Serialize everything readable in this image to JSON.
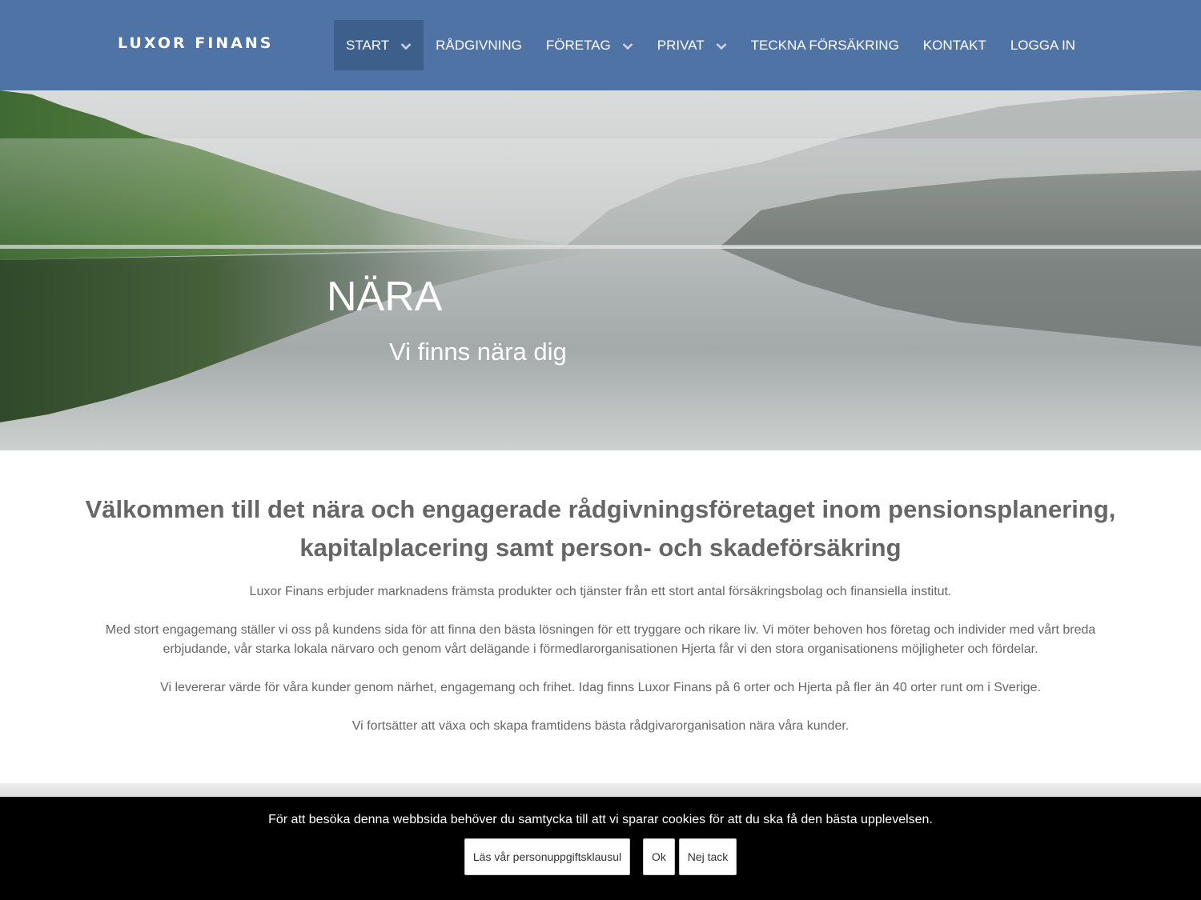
{
  "header": {
    "logo": "LUXOR FINANS",
    "nav": [
      {
        "label": "START",
        "has_dropdown": true,
        "active": true
      },
      {
        "label": "RÅDGIVNING",
        "has_dropdown": false,
        "active": false
      },
      {
        "label": "FÖRETAG",
        "has_dropdown": true,
        "active": false
      },
      {
        "label": "PRIVAT",
        "has_dropdown": true,
        "active": false
      },
      {
        "label": "TECKNA FÖRSÄKRING",
        "has_dropdown": false,
        "active": false
      },
      {
        "label": "KONTAKT",
        "has_dropdown": false,
        "active": false
      },
      {
        "label": "LOGGA IN",
        "has_dropdown": false,
        "active": false
      }
    ]
  },
  "hero": {
    "title": "NÄRA",
    "subtitle": "Vi finns nära dig"
  },
  "main": {
    "heading": "Välkommen till det nära och engagerade rådgivningsföretaget inom pensionsplanering, kapitalplacering samt person- och skadeförsäkring",
    "paragraphs": [
      "Luxor Finans erbjuder marknadens främsta produkter och tjänster från ett stort antal försäkringsbolag och finansiella institut.",
      "Med stort engagemang ställer vi oss på kundens sida för att finna den bästa lösningen för ett tryggare och rikare liv. Vi möter behoven hos företag och individer med vårt breda erbjudande, vår starka lokala närvaro och genom vårt delägande i förmedlarorganisationen Hjerta får vi den stora organisationens möjligheter och fördelar.",
      "Vi levererar värde för våra kunder genom närhet, engagemang och frihet. Idag finns Luxor Finans på 6 orter och Hjerta på fler än 40 orter runt om i Sverige.",
      "Vi fortsätter att växa och skapa framtidens bästa rådgivarorganisation nära våra kunder."
    ]
  },
  "cookie_bar": {
    "text": "För att besöka denna webbsida behöver du samtycka till att vi sparar cookies för att du ska få den bästa upplevelsen.",
    "policy_button": "Läs vår personuppgiftsklausul",
    "ok_button": "Ok",
    "decline_button": "Nej tack"
  },
  "colors": {
    "header_bg": "#4f73a4",
    "nav_active_bg": "#3d5f8c",
    "cookie_bg": "#000000",
    "body_text": "#666666"
  }
}
